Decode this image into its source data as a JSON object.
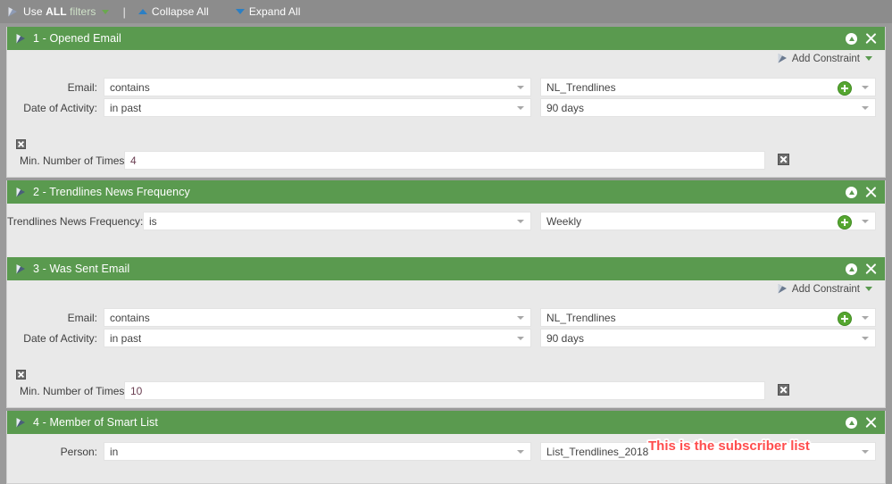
{
  "toolbar": {
    "use_all_filters": {
      "pre": "Use ",
      "bold": "ALL",
      "post": " filters"
    },
    "separator": "|",
    "collapse_all": "Collapse All",
    "expand_all": "Expand All"
  },
  "colors": {
    "panel_header_green": "#5a9a4f",
    "toolbar_grey": "#8c8c8c",
    "page_grey": "#9a9a9a",
    "panel_body_grey": "#e9e9e9",
    "field_white": "#ffffff",
    "accent_blue": "#2b7fc4",
    "plus_green": "#55a630",
    "annotation_red": "#ff4d4d"
  },
  "add_constraint_label": "Add Constraint",
  "panels": [
    {
      "id": 1,
      "title": "1 - Opened Email",
      "has_add_constraint": true,
      "rows": [
        {
          "label": "Email:",
          "operator": "contains",
          "value": "NL_Trendlines",
          "has_plus": true
        },
        {
          "label": "Date of Activity:",
          "operator": "in past",
          "value": "90 days",
          "has_plus": false
        }
      ],
      "constraint": {
        "label": "Min. Number of Times:",
        "value": "4"
      }
    },
    {
      "id": 2,
      "title": "2 - Trendlines News Frequency",
      "has_add_constraint": false,
      "rows": [
        {
          "label": "Trendlines News Frequency:",
          "operator": "is",
          "value": "Weekly",
          "has_plus": true,
          "wide_label": true
        }
      ],
      "constraint": null
    },
    {
      "id": 3,
      "title": "3 - Was Sent Email",
      "has_add_constraint": true,
      "rows": [
        {
          "label": "Email:",
          "operator": "contains",
          "value": "NL_Trendlines",
          "has_plus": true
        },
        {
          "label": "Date of Activity:",
          "operator": "in past",
          "value": "90 days",
          "has_plus": false
        }
      ],
      "constraint": {
        "label": "Min. Number of Times:",
        "value": "10"
      }
    },
    {
      "id": 4,
      "title": "4 - Member of Smart List",
      "has_add_constraint": false,
      "rows": [
        {
          "label": "Person:",
          "operator": "in",
          "value": "List_Trendlines_2018",
          "has_plus": false
        }
      ],
      "constraint": null
    }
  ],
  "annotations": [
    {
      "text": "This is the subscriber list"
    }
  ]
}
